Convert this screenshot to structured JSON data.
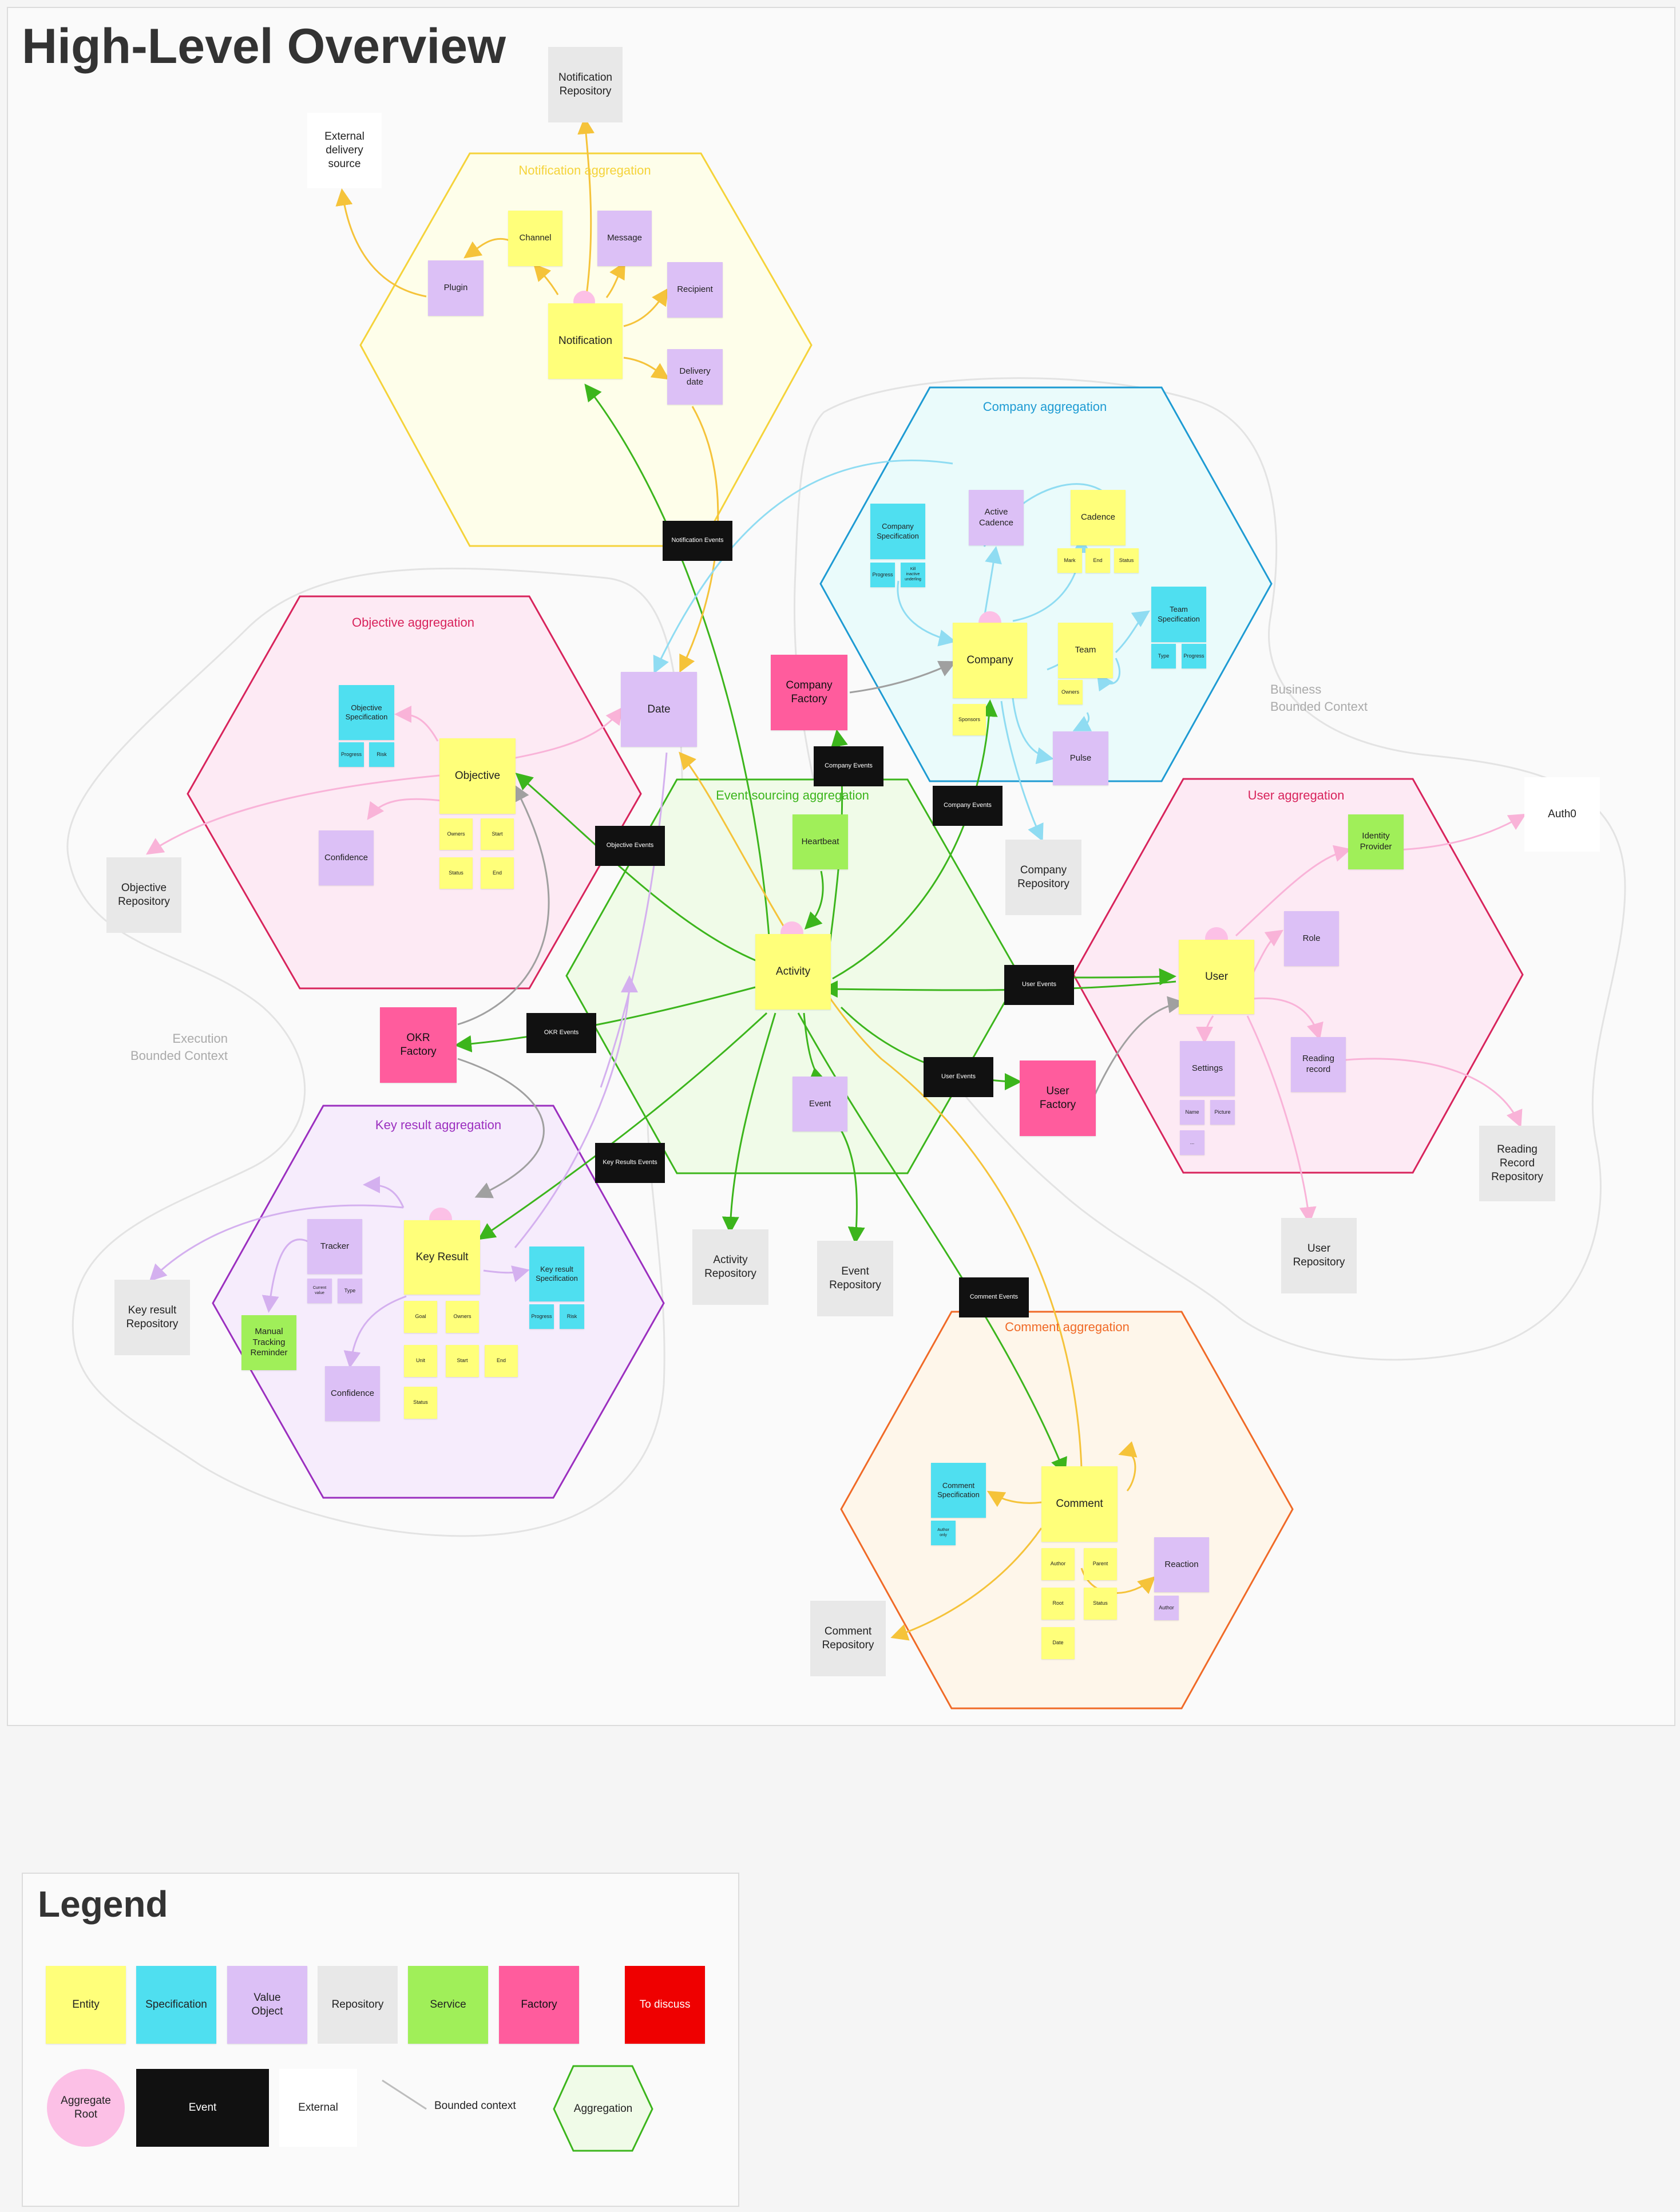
{
  "title": "High-Level Overview",
  "contexts": {
    "business": "Business\nBounded Context",
    "execution": "Execution\nBounded Context"
  },
  "aggregations": {
    "notification": {
      "title": "Notification aggregation",
      "color": "#f5d33a",
      "fill": "#fefeea"
    },
    "company": {
      "title": "Company aggregation",
      "color": "#1e9bd3",
      "fill": "#eafbfb"
    },
    "objective": {
      "title": "Objective aggregation",
      "color": "#d8245c",
      "fill": "#fdeaf4"
    },
    "event_sourcing": {
      "title": "Event sourcing aggregation",
      "color": "#3cb51c",
      "fill": "#f0fbe8"
    },
    "user": {
      "title": "User aggregation",
      "color": "#d8245c",
      "fill": "#fdeaf4"
    },
    "key_result": {
      "title": "Key result aggregation",
      "color": "#9b2fbf",
      "fill": "#f6ecfc"
    },
    "comment": {
      "title": "Comment aggregation",
      "color": "#f06a27",
      "fill": "#fef6ea"
    }
  },
  "notes": {
    "notification_repo": "Notification\nRepository",
    "external_delivery": "External\ndelivery\nsource",
    "channel": "Channel",
    "message": "Message",
    "plugin": "Plugin",
    "recipient": "Recipient",
    "notification": "Notification",
    "delivery_date": "Delivery\ndate",
    "notification_events": "Notification Events",
    "company_spec": "Company\nSpecification",
    "company_spec_progress": "Progress",
    "company_spec_kill": "Kill\ninactive\nunderling",
    "active_cadence": "Active\nCadence",
    "cadence": "Cadence",
    "cadence_mark": "Mark",
    "cadence_end": "End",
    "cadence_status": "Status",
    "team_spec": "Team\nSpecification",
    "team_spec_type": "Type",
    "team_spec_progress": "Progress",
    "company": "Company",
    "sponsors": "Sponsors",
    "team": "Team",
    "team_owners": "Owners",
    "pulse": "Pulse",
    "company_factory": "Company\nFactory",
    "company_events_1": "Company Events",
    "company_events_2": "Company Events",
    "company_repo": "Company\nRepository",
    "objective_spec": "Objective\nSpecification",
    "objective_spec_progress": "Progress",
    "objective_spec_risk": "Risk",
    "objective": "Objective",
    "objective_owners": "Owners",
    "objective_start": "Start",
    "objective_status": "Status",
    "objective_end": "End",
    "objective_confidence": "Confidence",
    "objective_repo": "Objective\nRepository",
    "date": "Date",
    "objective_events": "Objective Events",
    "heartbeat": "Heartbeat",
    "activity": "Activity",
    "okr_factory": "OKR\nFactory",
    "okr_events": "OKR Events",
    "event": "Event",
    "user_events_1": "User Events",
    "user_events_2": "User Events",
    "user_factory": "User\nFactory",
    "identity_provider": "Identity\nProvider",
    "auth0": "Auth0",
    "role": "Role",
    "user": "User",
    "settings": "Settings",
    "settings_name": "Name",
    "settings_picture": "Picture",
    "settings_more": "...",
    "reading_record": "Reading\nrecord",
    "reading_repo": "Reading\nRecord\nRepository",
    "user_repo": "User\nRepository",
    "key_result_events": "Key Results Events",
    "activity_repo": "Activity\nRepository",
    "event_repo": "Event\nRepository",
    "comment_events": "Comment Events",
    "tracker": "Tracker",
    "tracker_current": "Current\nvalue",
    "tracker_type": "Type",
    "key_result": "Key Result",
    "kr_spec": "Key result\nSpecification",
    "kr_spec_progress": "Progress",
    "kr_spec_risk": "Risk",
    "kr_goal": "Goal",
    "kr_owners": "Owners",
    "kr_unit": "Unit",
    "kr_start": "Start",
    "kr_end": "End",
    "kr_status": "Status",
    "manual_tracking": "Manual\nTracking\nReminder",
    "kr_repo": "Key result\nRepository",
    "kr_confidence": "Confidence",
    "comment_spec": "Comment\nSpecification",
    "comment_spec_sub": "Author\nonly",
    "comment": "Comment",
    "comment_author": "Author",
    "comment_parent": "Parent",
    "comment_root": "Root",
    "comment_status": "Status",
    "comment_date": "Date",
    "reaction": "Reaction",
    "reaction_author": "Author",
    "comment_repo": "Comment\nRepository"
  },
  "legend": {
    "title": "Legend",
    "entity": "Entity",
    "specification": "Specification",
    "value_object": "Value\nObject",
    "repository": "Repository",
    "service": "Service",
    "factory": "Factory",
    "to_discuss": "To discuss",
    "aggregate_root": "Aggregate\nRoot",
    "event": "Event",
    "external": "External",
    "bounded_context": "Bounded context",
    "aggregation": "Aggregation"
  },
  "colors": {
    "green_arrow": "#3cb51c",
    "yellow_arrow": "#f5c33a",
    "pink_arrow": "#f9b3d8",
    "blue_arrow": "#8fdcf2",
    "gray_arrow": "#a0a0a0",
    "purple_arrow": "#d4b0ef"
  }
}
